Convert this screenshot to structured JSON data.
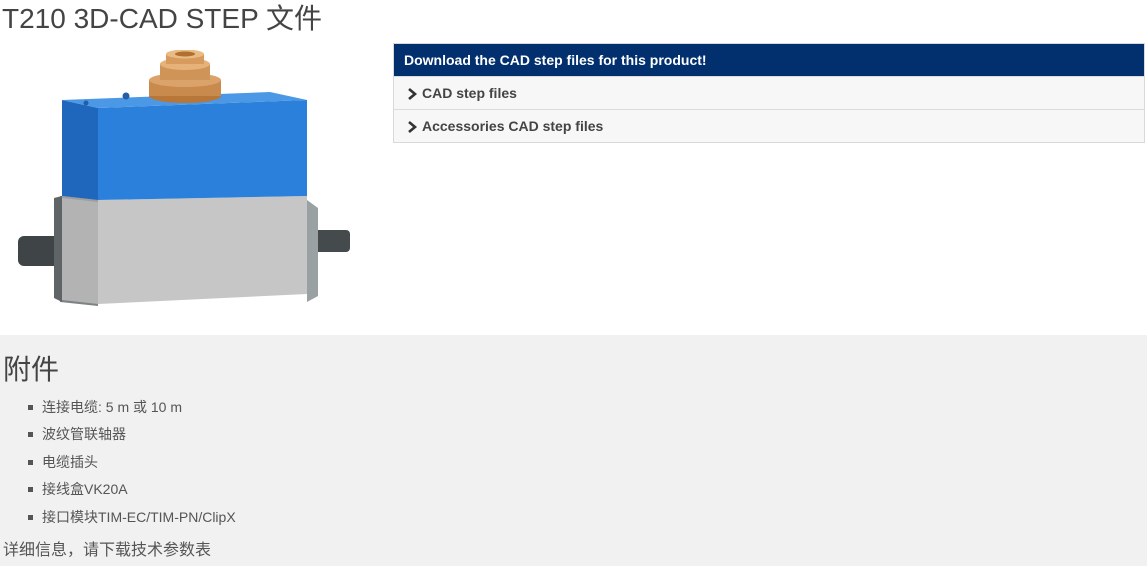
{
  "page": {
    "title": "T210 3D-CAD STEP 文件"
  },
  "download": {
    "header": "Download the CAD step files for this product!",
    "items": [
      {
        "label": "CAD step files",
        "icon": "chevron-right-icon"
      },
      {
        "label": "Accessories CAD step files",
        "icon": "chevron-right-icon"
      }
    ]
  },
  "accessories": {
    "title": "附件",
    "items": [
      "连接电缆: 5 m 或 10 m",
      "波纹管联轴器",
      "电缆插头",
      "接线盒VK20A",
      "接口模块TIM-EC/TIM-PN/ClipX"
    ],
    "note": "详细信息，请下载技术参数表"
  },
  "colors": {
    "header_bg": "#02306e",
    "housing_top": "#2a7fd8",
    "housing_bottom": "#c4c4c4",
    "connector": "#c98a4e",
    "section_bg": "#f0f1f0"
  }
}
